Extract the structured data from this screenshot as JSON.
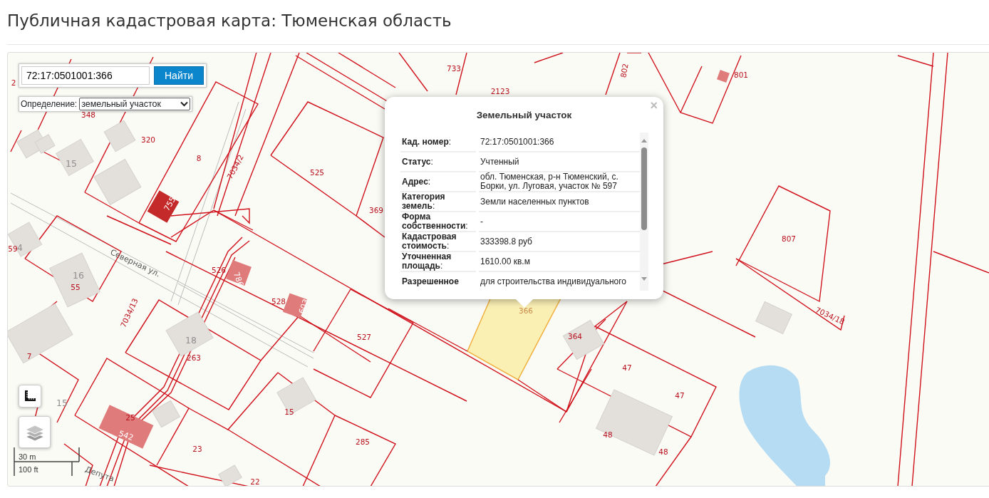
{
  "page_title": "Публичная кадастровая карта: Тюменская область",
  "search": {
    "value": "72:17:0501001:366",
    "button": "Найти"
  },
  "identify": {
    "label": "Определение:",
    "value": "земельный участок"
  },
  "popup": {
    "title": "Земельный участок",
    "close": "×",
    "rows": [
      {
        "label": "**Кад. номер**:",
        "value": "72:17:0501001:366"
      },
      {
        "label": "**Статус**:",
        "value": "Учтенный"
      },
      {
        "label": "**Адрес**:",
        "value": "обл. Тюменская, р-н Тюменский, с. Борки, ул. Луговая, участок № 597"
      },
      {
        "label": "**Категория земель**:",
        "value": "Земли населенных пунктов"
      },
      {
        "label": "**Форма собственности**:",
        "value": "-"
      },
      {
        "label": "**Кадастровая стоимость**:",
        "value": "333398.8 руб"
      },
      {
        "label": "**Уточненная площадь**:",
        "value": "1610.00 кв.м"
      },
      {
        "label": "**Разрешенное**",
        "value": "для строительства индивидуального"
      }
    ]
  },
  "map_labels": [
    {
      "text": "2",
      "kind": "parcel"
    },
    {
      "text": "733",
      "kind": "parcel"
    },
    {
      "text": "2123",
      "kind": "parcel"
    },
    {
      "text": "802",
      "kind": "parcel"
    },
    {
      "text": "801",
      "kind": "parcel"
    },
    {
      "text": "348",
      "kind": "parcel"
    },
    {
      "text": "320",
      "kind": "parcel"
    },
    {
      "text": "8",
      "kind": "parcel"
    },
    {
      "text": "7034/2",
      "kind": "parcel"
    },
    {
      "text": "525",
      "kind": "parcel"
    },
    {
      "text": "369",
      "kind": "parcel"
    },
    {
      "text": "15",
      "kind": "house"
    },
    {
      "text": "755",
      "kind": "building"
    },
    {
      "text": "807",
      "kind": "parcel"
    },
    {
      "text": "59",
      "kind": "parcel"
    },
    {
      "text": "Северная ул.",
      "kind": "street"
    },
    {
      "text": "526",
      "kind": "parcel"
    },
    {
      "text": "786",
      "kind": "building"
    },
    {
      "text": "528",
      "kind": "parcel"
    },
    {
      "text": "603",
      "kind": "building"
    },
    {
      "text": "527",
      "kind": "parcel"
    },
    {
      "text": "366",
      "kind": "selected"
    },
    {
      "text": "364",
      "kind": "parcel"
    },
    {
      "text": "16",
      "kind": "house"
    },
    {
      "text": "55",
      "kind": "parcel"
    },
    {
      "text": "7034/13",
      "kind": "parcel"
    },
    {
      "text": "18",
      "kind": "house"
    },
    {
      "text": "263",
      "kind": "parcel"
    },
    {
      "text": "7",
      "kind": "parcel"
    },
    {
      "text": "15",
      "kind": "house"
    },
    {
      "text": "47",
      "kind": "parcel"
    },
    {
      "text": "47",
      "kind": "parcel"
    },
    {
      "text": "25",
      "kind": "parcel"
    },
    {
      "text": "542",
      "kind": "building"
    },
    {
      "text": "15",
      "kind": "parcel"
    },
    {
      "text": "285",
      "kind": "parcel"
    },
    {
      "text": "23",
      "kind": "parcel"
    },
    {
      "text": "48",
      "kind": "parcel"
    },
    {
      "text": "48",
      "kind": "parcel"
    },
    {
      "text": "7034/18",
      "kind": "parcel"
    },
    {
      "text": "22",
      "kind": "parcel"
    },
    {
      "text": "Депута",
      "kind": "street"
    },
    {
      "text": "4",
      "kind": "house"
    }
  ],
  "scale": {
    "metric": "30 m",
    "imperial": "100 ft"
  }
}
